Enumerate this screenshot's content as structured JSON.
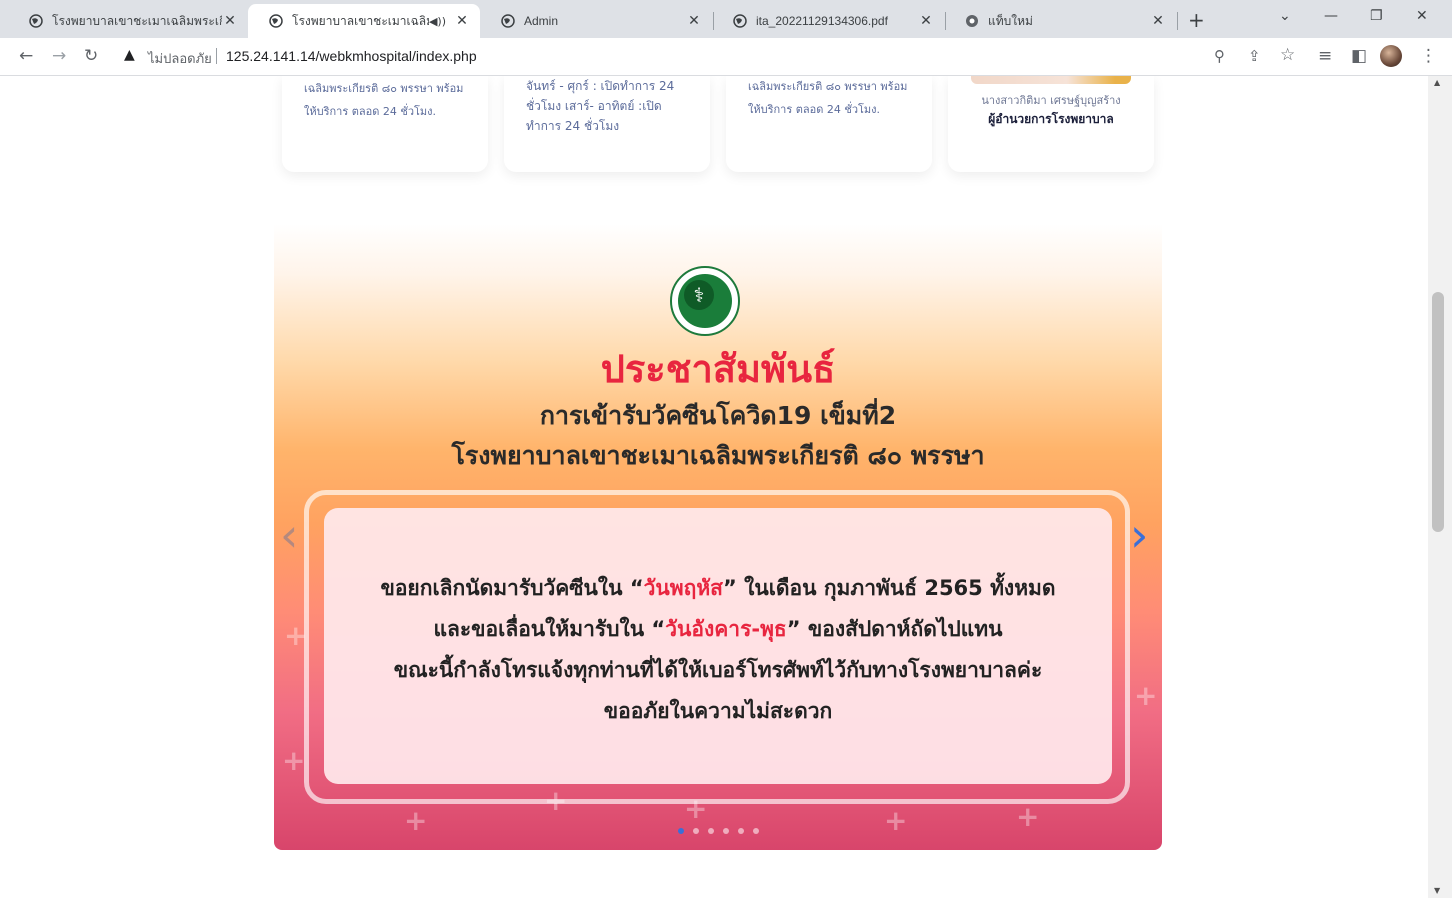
{
  "tabs": [
    {
      "title": "โรงพยาบาลเขาชะเมาเฉลิมพระเกียรติ",
      "active": false
    },
    {
      "title": "โรงพยาบาลเขาชะเมาเฉลิมพระเกี",
      "active": true
    },
    {
      "title": "Admin",
      "active": false
    },
    {
      "title": "ita_20221129134306.pdf",
      "active": false
    },
    {
      "title": "แท็บใหม่",
      "active": false
    }
  ],
  "toolbar": {
    "security_label": "ไม่ปลอดภัย",
    "url": "125.24.141.14/webkmhospital/index.php"
  },
  "cards": [
    {
      "lines": [
        "เฉลิมพระเกียรติ ๘๐ พรรษา พร้อม",
        "ให้บริการ ตลอด 24 ชั่วโมง."
      ]
    },
    {
      "lines": [
        "จันทร์ - ศุกร์ : เปิดทำการ 24",
        "ชั่วโมง เสาร์- อาทิตย์ :เปิด",
        "ทำการ 24 ชั่วโมง"
      ]
    },
    {
      "lines": [
        "เฉลิมพระเกียรติ ๘๐ พรรษา พร้อม",
        "ให้บริการ ตลอด 24 ชั่วโมง."
      ]
    }
  ],
  "director": {
    "name": "นางสาวกิติมา เศรษฐ์บุญสร้าง",
    "title": "ผู้อำนวยการโรงพยาบาล"
  },
  "banner": {
    "headline": "ประชาสัมพันธ์",
    "subtitle_1": "การเข้ารับวัคซีนโควิด19 เข็มที่2",
    "subtitle_2": "โรงพยาบาลเขาชะเมาเฉลิมพระเกียรติ ๘๐ พรรษา",
    "notice": {
      "line1_a": "ขอยกเลิกนัดมารับวัคซีนใน “",
      "line1_hl": "วันพฤหัส",
      "line1_b": "” ในเดือน กุมภาพันธ์ 2565 ทั้งหมด",
      "line2_a": "และขอเลื่อนให้มารับใน “",
      "line2_hl": "วันอังคาร-พุธ",
      "line2_b": "” ของสัปดาห์ถัดไปแทน",
      "line3": "ขณะนี้กำลังโทรแจ้งทุกท่านที่ได้ให้เบอร์โทรศัพท์ไว้กับทางโรงพยาบาลค่ะ",
      "line4": "ขออภัยในความไม่สะดวก"
    },
    "carousel": {
      "slide_count": 6,
      "active_index": 0
    }
  },
  "colors": {
    "headline_red": "#e8253f",
    "carousel_blue": "#3a6fd8",
    "card_text": "#5b6b9a"
  },
  "icons": [
    "globe-icon",
    "speaker-icon",
    "close-icon",
    "plus-icon",
    "chevron-down-icon",
    "minimize-icon",
    "restore-icon",
    "back-icon",
    "forward-icon",
    "reload-icon",
    "warning-icon",
    "zoom-icon",
    "share-icon",
    "star-icon",
    "reading-list-icon",
    "side-panel-icon",
    "menu-icon"
  ]
}
